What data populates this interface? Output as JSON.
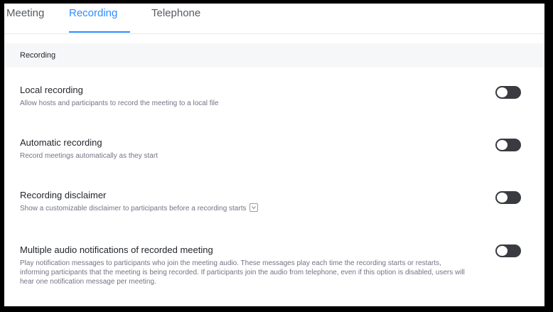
{
  "tabs": [
    {
      "label": "Meeting",
      "active": false
    },
    {
      "label": "Recording",
      "active": true
    },
    {
      "label": "Telephone",
      "active": false
    }
  ],
  "section": {
    "title": "Recording"
  },
  "settings": [
    {
      "title": "Local recording",
      "description": "Allow hosts and participants to record the meeting to a local file",
      "enabled": false
    },
    {
      "title": "Automatic recording",
      "description": "Record meetings automatically as they start",
      "enabled": false
    },
    {
      "title": "Recording disclaimer",
      "description": "Show a customizable disclaimer to participants before a recording starts",
      "enabled": false,
      "has_info_icon": true
    },
    {
      "title": "Multiple audio notifications of recorded meeting",
      "description": "Play notification messages to participants who join the meeting audio. These messages play each time the recording starts or restarts, informing participants that the meeting is being recorded. If participants join the audio from telephone, even if this option is disabled, users will hear one notification message per meeting.",
      "enabled": false
    }
  ],
  "colors": {
    "accent": "#2d8cff",
    "toggle_off": "#3a3b40",
    "section_bg": "#f6f7f9"
  },
  "icons": {
    "info": "chevron-down-box-icon"
  }
}
